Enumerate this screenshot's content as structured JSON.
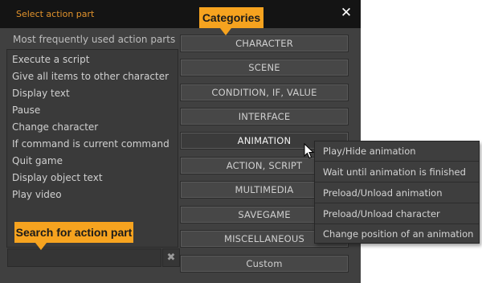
{
  "dialog": {
    "title": "Select action part",
    "close_glyph": "✕"
  },
  "frequent": {
    "label": "Most frequently used action parts",
    "items": [
      "Execute a script",
      "Give all items to other character",
      "Display text",
      "Pause",
      "Change character",
      "If command is current command",
      "Quit game",
      "Display object text",
      "Play video"
    ]
  },
  "search": {
    "value": "",
    "placeholder": "",
    "clear_glyph": "✖"
  },
  "categories": [
    "CHARACTER",
    "SCENE",
    "CONDITION, IF, VALUE",
    "INTERFACE",
    "ANIMATION",
    "ACTION, SCRIPT",
    "MULTIMEDIA",
    "SAVEGAME",
    "MISCELLANEOUS",
    "Custom"
  ],
  "active_category": "ANIMATION",
  "animation_submenu": [
    "Play/Hide animation",
    "Wait until animation is finished",
    "Preload/Unload animation",
    "Preload/Unload character",
    "Change position of an animation"
  ],
  "callouts": {
    "categories": "Categories",
    "search": "Search for action part"
  },
  "colors": {
    "accent": "#f6a31f",
    "title_text": "#e2932c",
    "panel_bg": "#404040",
    "titlebar_bg": "#141414"
  }
}
